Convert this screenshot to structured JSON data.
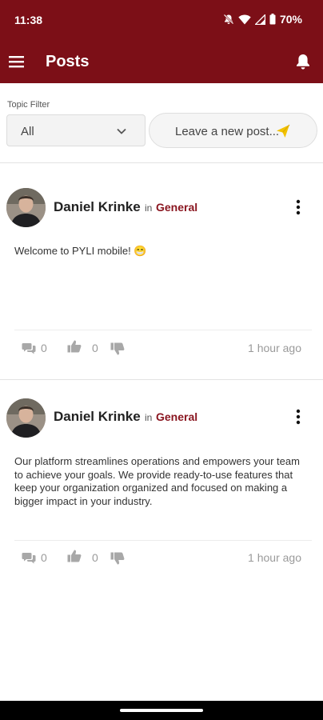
{
  "status_bar": {
    "time": "11:38",
    "battery": "70%"
  },
  "app_bar": {
    "title": "Posts"
  },
  "filter": {
    "label": "Topic Filter",
    "value": "All"
  },
  "new_post": {
    "label": "Leave a new post..."
  },
  "posts": [
    {
      "author": "Daniel Krinke",
      "in_label": "in",
      "topic": "General",
      "body": "Welcome to PYLI mobile! 😁",
      "comments": "0",
      "likes": "0",
      "time": "1 hour ago"
    },
    {
      "author": "Daniel Krinke",
      "in_label": "in",
      "topic": "General",
      "body": "Our platform streamlines operations and empowers your team to achieve your goals. We provide ready-to-use features that keep your organization organized and focused on making a bigger impact in your industry.",
      "comments": "0",
      "likes": "0",
      "time": "1 hour ago"
    }
  ],
  "colors": {
    "brand": "#7c0f17",
    "topic": "#8a1620",
    "send_icon": "#f2c200"
  },
  "icons": [
    "menu-icon",
    "bell-icon",
    "chevron-down-icon",
    "send-icon",
    "more-vert-icon",
    "comments-icon",
    "thumbs-up-icon",
    "thumbs-down-icon"
  ]
}
